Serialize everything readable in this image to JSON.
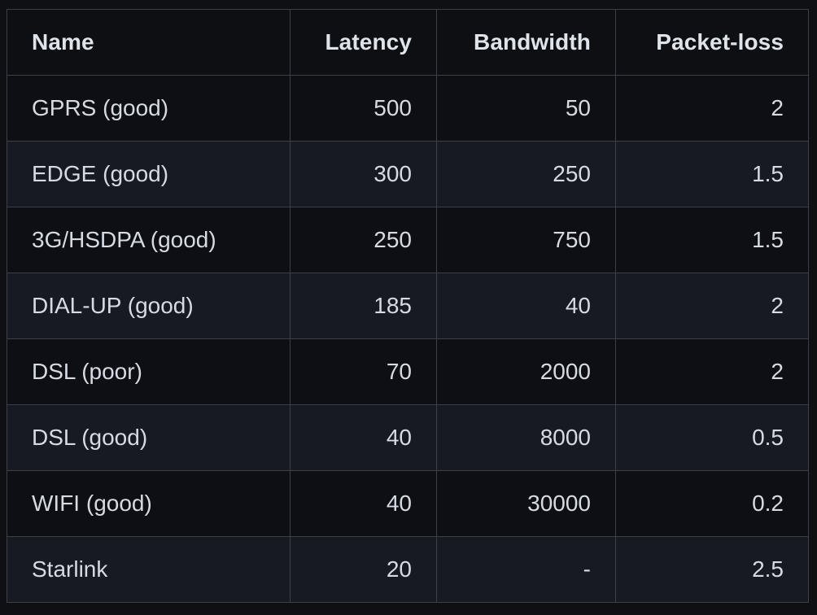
{
  "table": {
    "columns": [
      {
        "key": "name",
        "label": "Name",
        "align": "left"
      },
      {
        "key": "latency",
        "label": "Latency",
        "align": "right"
      },
      {
        "key": "bandwidth",
        "label": "Bandwidth",
        "align": "right"
      },
      {
        "key": "packet_loss",
        "label": "Packet-loss",
        "align": "right"
      }
    ],
    "rows": [
      {
        "name": "GPRS (good)",
        "latency": "500",
        "bandwidth": "50",
        "packet_loss": "2"
      },
      {
        "name": "EDGE (good)",
        "latency": "300",
        "bandwidth": "250",
        "packet_loss": "1.5"
      },
      {
        "name": "3G/HSDPA (good)",
        "latency": "250",
        "bandwidth": "750",
        "packet_loss": "1.5"
      },
      {
        "name": "DIAL-UP (good)",
        "latency": "185",
        "bandwidth": "40",
        "packet_loss": "2"
      },
      {
        "name": "DSL (poor)",
        "latency": "70",
        "bandwidth": "2000",
        "packet_loss": "2"
      },
      {
        "name": "DSL (good)",
        "latency": "40",
        "bandwidth": "8000",
        "packet_loss": "0.5"
      },
      {
        "name": "WIFI (good)",
        "latency": "40",
        "bandwidth": "30000",
        "packet_loss": "0.2"
      },
      {
        "name": "Starlink",
        "latency": "20",
        "bandwidth": "-",
        "packet_loss": "2.5"
      }
    ]
  },
  "colors": {
    "page_background": "#0e1014",
    "cell_background_odd": "#0d0f14",
    "cell_background_even": "#171a21",
    "border": "#3b4048",
    "text": "#d6dae2",
    "header_text": "#dfe3ea"
  }
}
